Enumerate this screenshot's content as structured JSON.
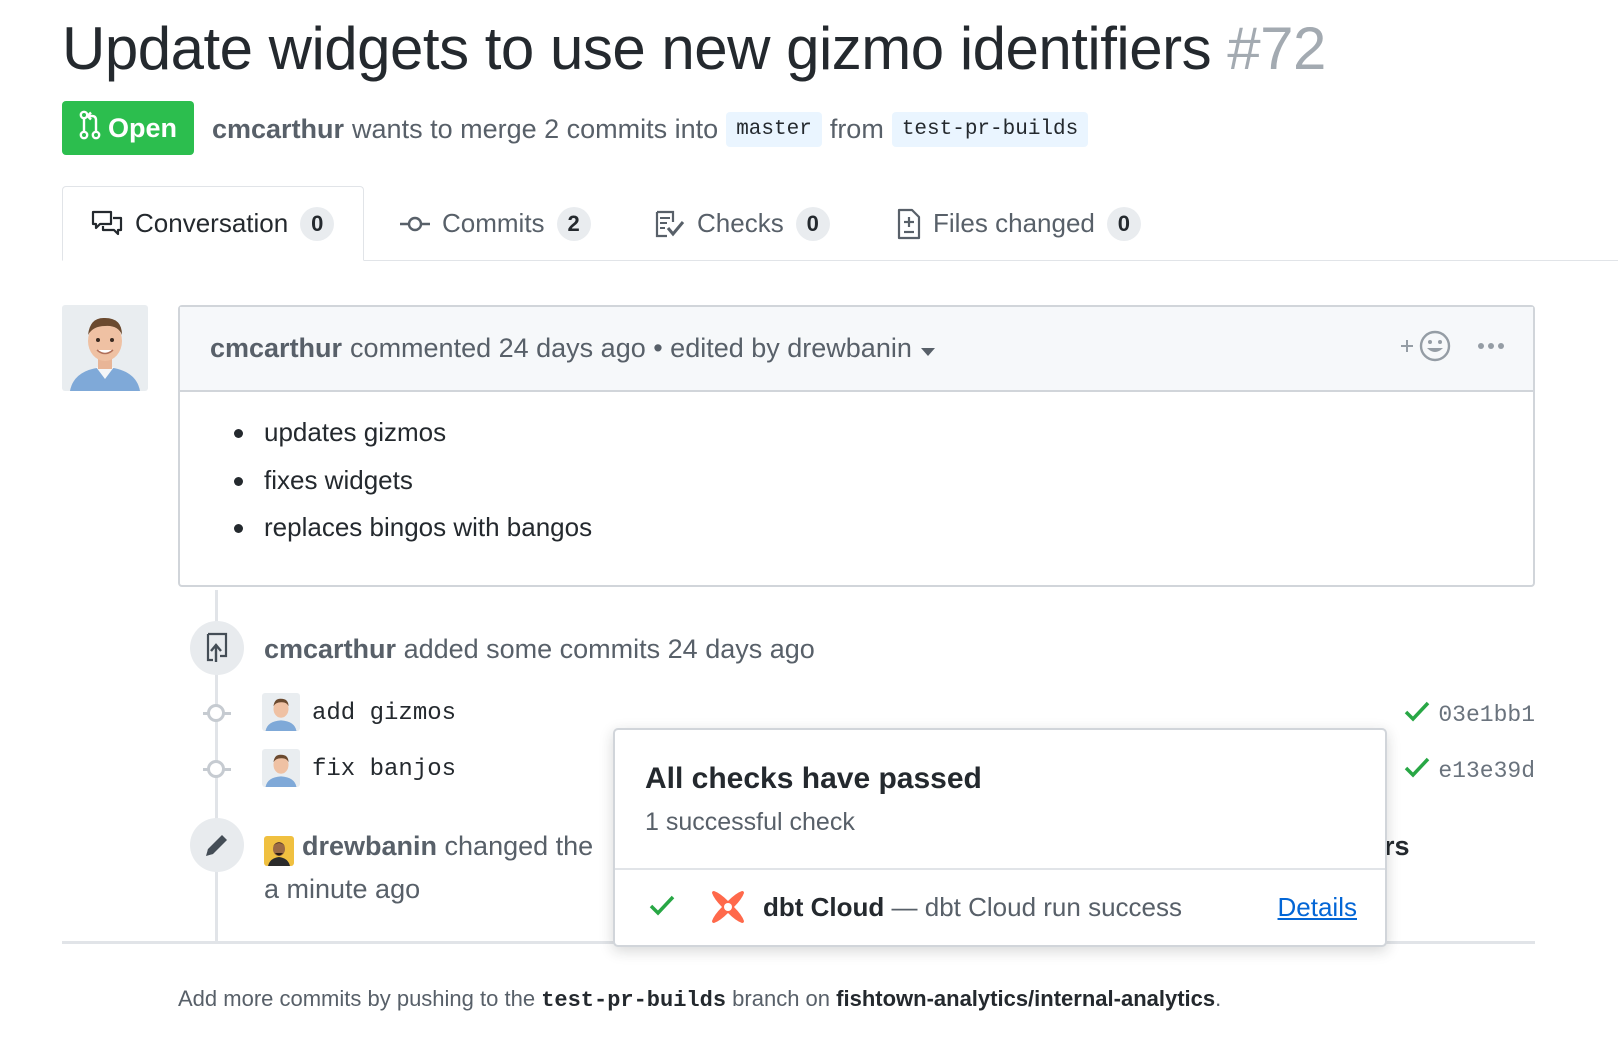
{
  "pr": {
    "title": "Update widgets to use new gizmo identifiers",
    "number": "#72",
    "state": "Open",
    "author": "cmcarthur",
    "merge_text": "wants to merge 2 commits into",
    "base_branch": "master",
    "from_text": "from",
    "head_branch": "test-pr-builds"
  },
  "tabs": [
    {
      "label": "Conversation",
      "count": "0",
      "icon": "comment-discussion-icon"
    },
    {
      "label": "Commits",
      "count": "2",
      "icon": "git-commit-icon"
    },
    {
      "label": "Checks",
      "count": "0",
      "icon": "checklist-icon"
    },
    {
      "label": "Files changed",
      "count": "0",
      "icon": "file-diff-icon"
    }
  ],
  "comment": {
    "author": "cmcarthur",
    "meta": "commented 24 days ago • edited by drewbanin",
    "reaction_icon": "add-reaction-icon",
    "menu_icon": "kebab-horizontal-icon",
    "items": [
      "updates gizmos",
      "fixes widgets",
      "replaces bingos with bangos"
    ]
  },
  "timeline": {
    "commits_event": {
      "author": "cmcarthur",
      "text": "added some commits 24 days ago"
    },
    "commits": [
      {
        "message": "add gizmos",
        "sha": "03e1bb1"
      },
      {
        "message": "fix banjos",
        "sha": "e13e39d"
      }
    ],
    "rename_event": {
      "author": "drewbanin",
      "text": "changed the",
      "tail": "rs",
      "time": "a minute ago"
    }
  },
  "checks_popover": {
    "title": "All checks have passed",
    "subtitle": "1 successful check",
    "check_name": "dbt Cloud",
    "check_desc": "— dbt Cloud run success",
    "details_label": "Details"
  },
  "footer": {
    "prefix": "Add more commits by pushing to the",
    "branch": "test-pr-builds",
    "middle": "branch on",
    "repo": "fishtown-analytics/internal-analytics",
    "suffix": "."
  },
  "colors": {
    "open_green": "#2cbe4e",
    "link_blue": "#0366d6",
    "check_green": "#28a745",
    "dbt_orange": "#ff694b"
  }
}
